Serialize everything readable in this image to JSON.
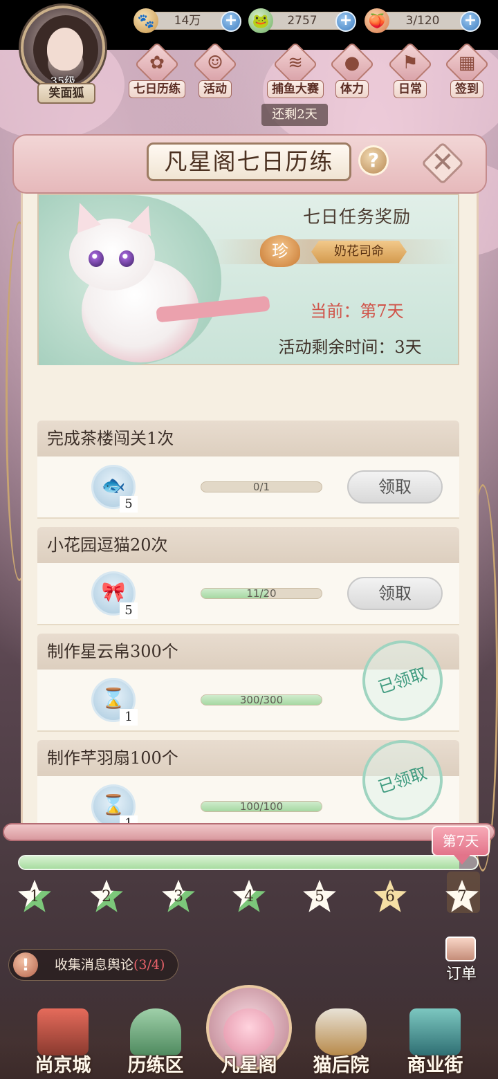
{
  "player": {
    "level": "35级",
    "name": "笑面狐"
  },
  "resources": [
    {
      "icon": "paw-coin-icon",
      "value": "14万"
    },
    {
      "icon": "jade-frog-icon",
      "value": "2757"
    },
    {
      "icon": "stamina-bun-icon",
      "value": "3/120"
    }
  ],
  "activities": [
    {
      "icon": "scroll-medal-icon",
      "label": "七日历练"
    },
    {
      "icon": "cat-mask-icon",
      "label": "活动"
    },
    {
      "icon": "fishing-icon",
      "label": "捕鱼大赛"
    },
    {
      "icon": "dumpling-icon",
      "label": "体力"
    },
    {
      "icon": "flag-icon",
      "label": "日常"
    },
    {
      "icon": "calendar-icon",
      "label": "签到"
    }
  ],
  "event_remaining_tag": "还剩2天",
  "panel": {
    "title": "凡星阁七日历练",
    "help": "?",
    "close": "✕"
  },
  "banner": {
    "title": "七日任务奖励",
    "rarity": "珍",
    "reward_name": "奶花司命",
    "current_day": "当前：第7天",
    "time_left": "活动剩余时间：3天"
  },
  "tasks": [
    {
      "name": "完成茶楼闯关1次",
      "item_icon": "fish-cake-icon",
      "item_count": "5",
      "progress_text": "0/1",
      "progress": 0.0,
      "status": "claim",
      "button": "领取"
    },
    {
      "name": "小花园逗猫20次",
      "item_icon": "cat-teaser-icon",
      "item_count": "5",
      "progress_text": "11/20",
      "progress": 0.55,
      "status": "claim",
      "button": "领取"
    },
    {
      "name": "制作星云帛300个",
      "item_icon": "hourglass-icon",
      "item_count": "1",
      "progress_text": "300/300",
      "progress": 1.0,
      "status": "claimed",
      "button": "已领取"
    },
    {
      "name": "制作芊羽扇100个",
      "item_icon": "hourglass-icon",
      "item_count": "1",
      "progress_text": "100/100",
      "progress": 1.0,
      "status": "claimed",
      "button": "已领取"
    }
  ],
  "day_progress": {
    "tag": "第7天",
    "fill": 0.96,
    "days": [
      {
        "num": "1",
        "state": "done"
      },
      {
        "num": "2",
        "state": "done"
      },
      {
        "num": "3",
        "state": "done"
      },
      {
        "num": "4",
        "state": "done"
      },
      {
        "num": "5",
        "state": "open"
      },
      {
        "num": "6",
        "state": "current"
      },
      {
        "num": "7",
        "state": "open"
      }
    ]
  },
  "side": {
    "order_label": "订单"
  },
  "news": {
    "icon": "!",
    "text": "收集消息舆论",
    "count": "(3/4)"
  },
  "nav": [
    {
      "icon": "city-gate-icon",
      "label": "尚京城"
    },
    {
      "icon": "mountain-icon",
      "label": "历练区"
    },
    {
      "icon": "blossom-tree-icon",
      "label": "凡星阁",
      "active": true
    },
    {
      "icon": "cat-basket-icon",
      "label": "猫后院"
    },
    {
      "icon": "market-gate-icon",
      "label": "商业街"
    }
  ],
  "colors": {
    "accent_pink": "#e2748a",
    "progress_green": "#a6d8a2",
    "claimed_teal": "#3f9b7f",
    "alert_red": "#d0544a"
  }
}
